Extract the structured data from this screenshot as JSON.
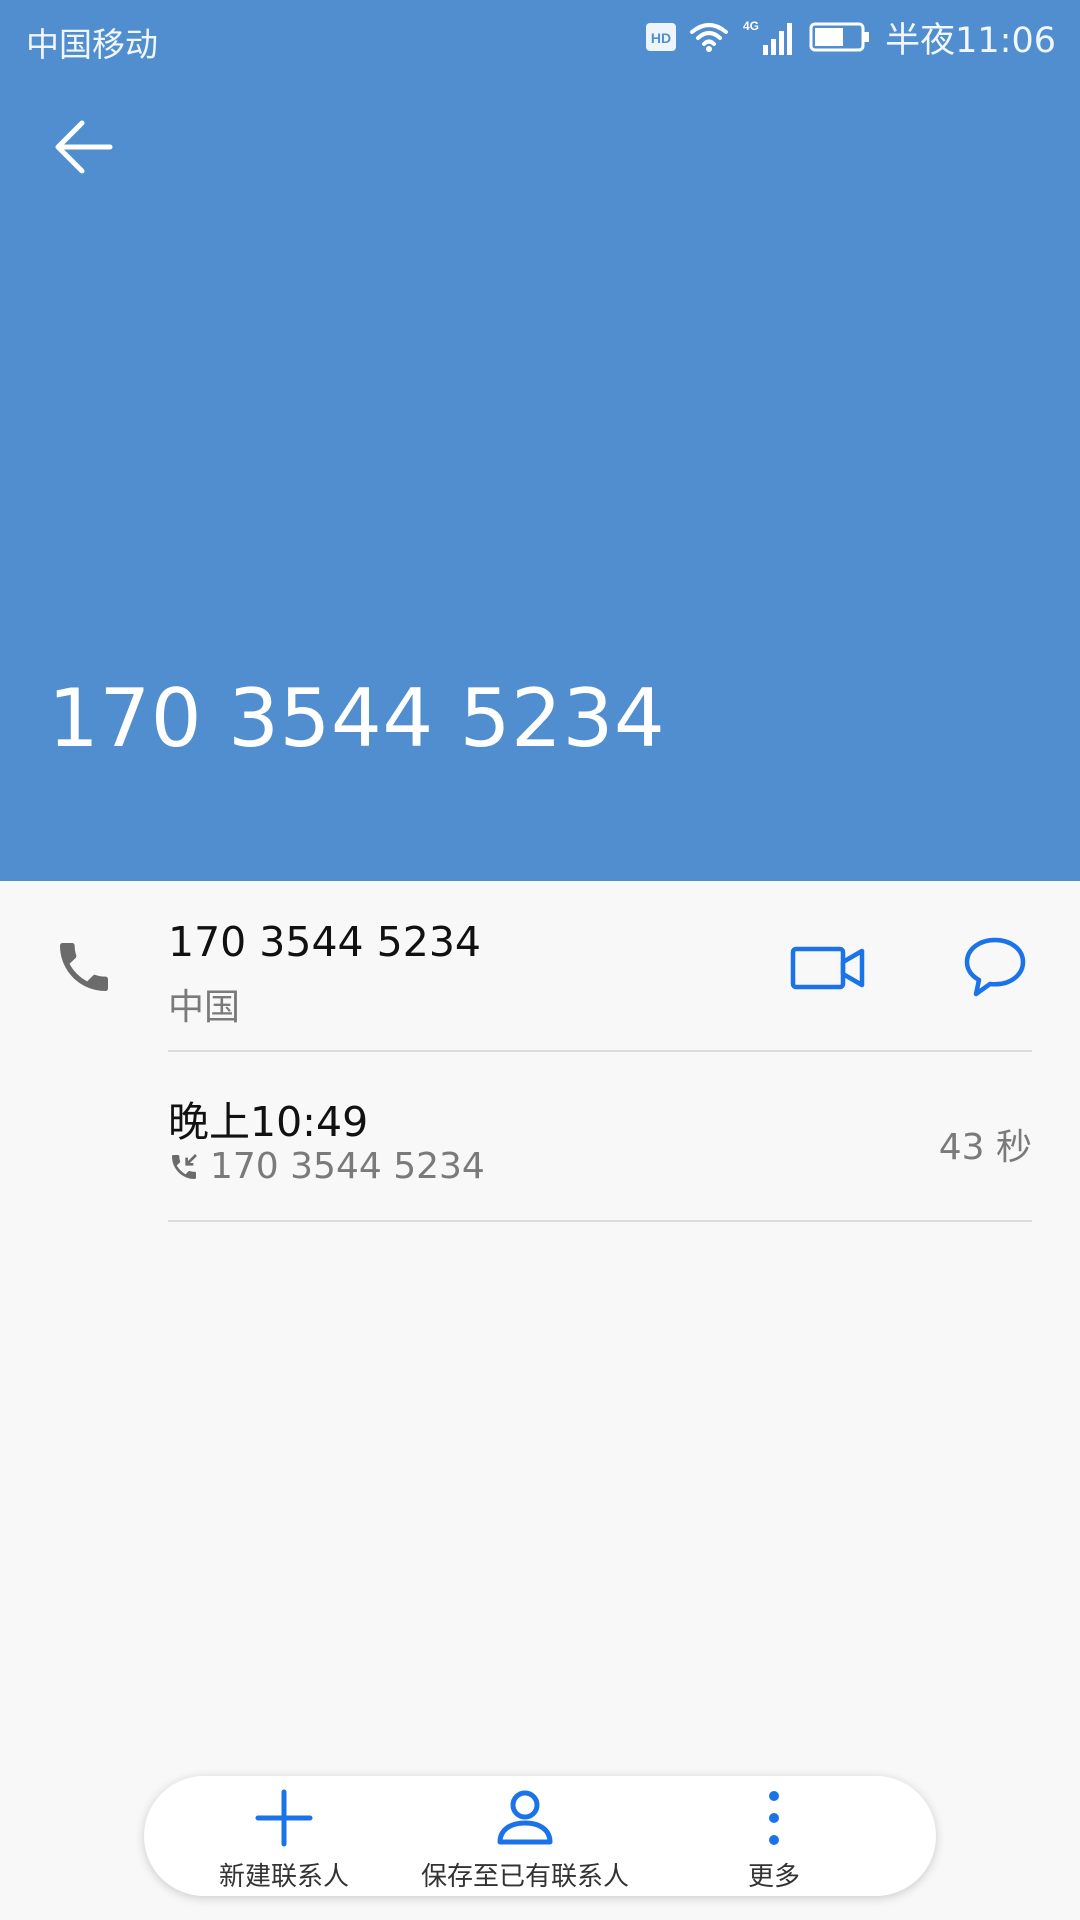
{
  "status_bar": {
    "carrier": "中国移动",
    "hd_badge": "HD",
    "network": "4G",
    "clock": "半夜11:06"
  },
  "header": {
    "phone_number": "170 3544 5234"
  },
  "number_row": {
    "number": "170 3544 5234",
    "location": "中国"
  },
  "call_log": {
    "time": "晚上10:49",
    "number": "170 3544 5234",
    "duration": "43 秒"
  },
  "bottom_bar": {
    "new_contact": "新建联系人",
    "save_existing": "保存至已有联系人",
    "more": "更多"
  },
  "colors": {
    "header_bg": "#518ecf",
    "accent": "#1a73e8"
  }
}
